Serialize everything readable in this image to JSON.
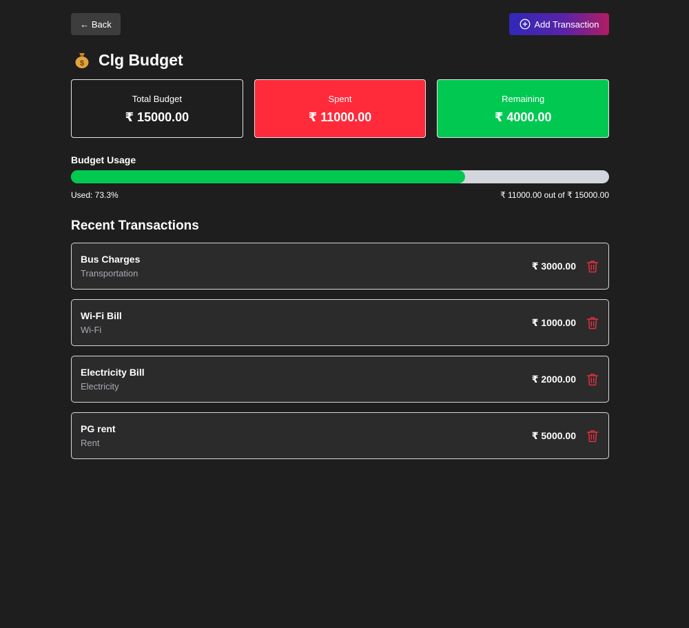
{
  "header": {
    "back_label": "← Back",
    "add_label": "Add Transaction",
    "title": "Clg Budget",
    "title_icon": "moneybag-icon"
  },
  "summary": {
    "total": {
      "label": "Total Budget",
      "value": "₹ 15000.00"
    },
    "spent": {
      "label": "Spent",
      "value": "₹ 11000.00"
    },
    "remaining": {
      "label": "Remaining",
      "value": "₹ 4000.00"
    }
  },
  "usage": {
    "title": "Budget Usage",
    "used_text": "Used: 73.3%",
    "used_fraction": 0.733,
    "detail_text": "₹ 11000.00 out of ₹ 15000.00"
  },
  "transactions": {
    "title": "Recent Transactions",
    "items": [
      {
        "name": "Bus Charges",
        "category": "Transportation",
        "amount": "₹ 3000.00"
      },
      {
        "name": "Wi-Fi Bill",
        "category": "Wi-Fi",
        "amount": "₹ 1000.00"
      },
      {
        "name": "Electricity Bill",
        "category": "Electricity",
        "amount": "₹ 2000.00"
      },
      {
        "name": "PG rent",
        "category": "Rent",
        "amount": "₹ 5000.00"
      }
    ]
  },
  "colors": {
    "background": "#1e1e1e",
    "spent": "#ff2a3a",
    "remaining": "#00c851",
    "delete_icon": "#e0313d"
  },
  "icons": {
    "add": "plus-circle-icon",
    "delete": "trash-icon"
  }
}
